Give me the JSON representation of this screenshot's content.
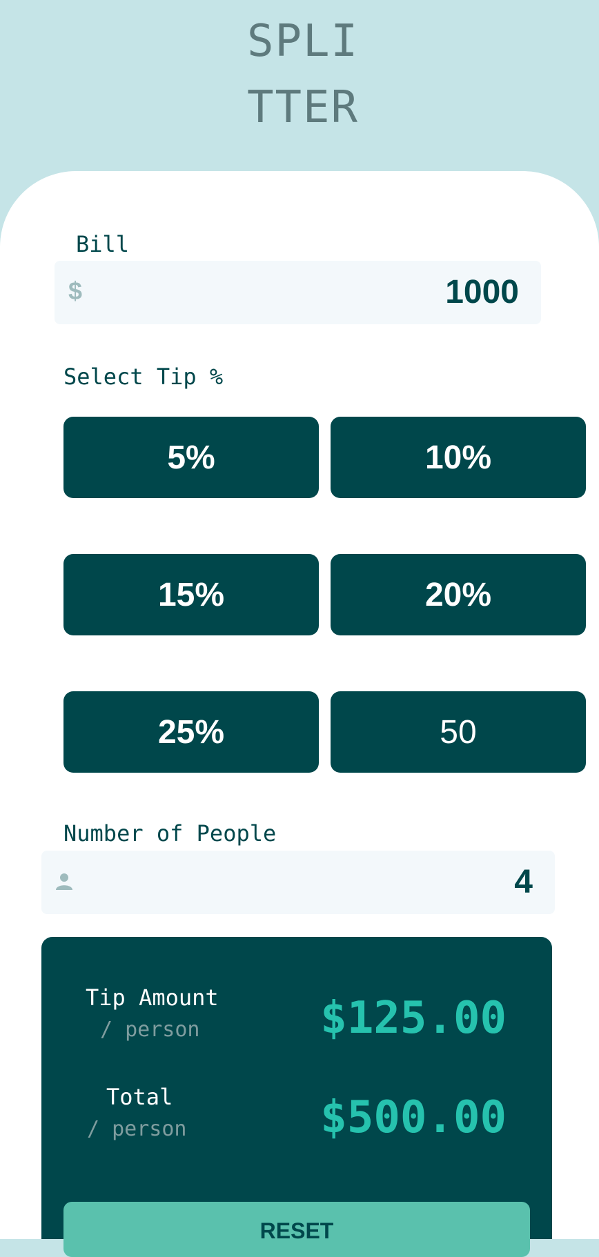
{
  "logo": {
    "line1": "SPLI",
    "line2": "TTER"
  },
  "bill": {
    "label": "Bill",
    "currency_icon": "$",
    "value": "1000"
  },
  "tip": {
    "label": "Select Tip %",
    "options": [
      "5%",
      "10%",
      "15%",
      "20%",
      "25%"
    ],
    "custom_value": "50"
  },
  "people": {
    "label": "Number of People",
    "icon": "person-icon",
    "value": "4"
  },
  "results": {
    "tip_amount": {
      "title": "Tip Amount",
      "sub": "/ person",
      "value": "$125.00"
    },
    "total": {
      "title": "Total",
      "sub": "/ person",
      "value": "$500.00"
    },
    "reset_label": "RESET"
  },
  "colors": {
    "background": "#c5e4e7",
    "dark_cyan": "#00474b",
    "accent": "#26c2ae",
    "reset_bg": "#5ac1ad",
    "input_bg": "#f3f8fb"
  }
}
